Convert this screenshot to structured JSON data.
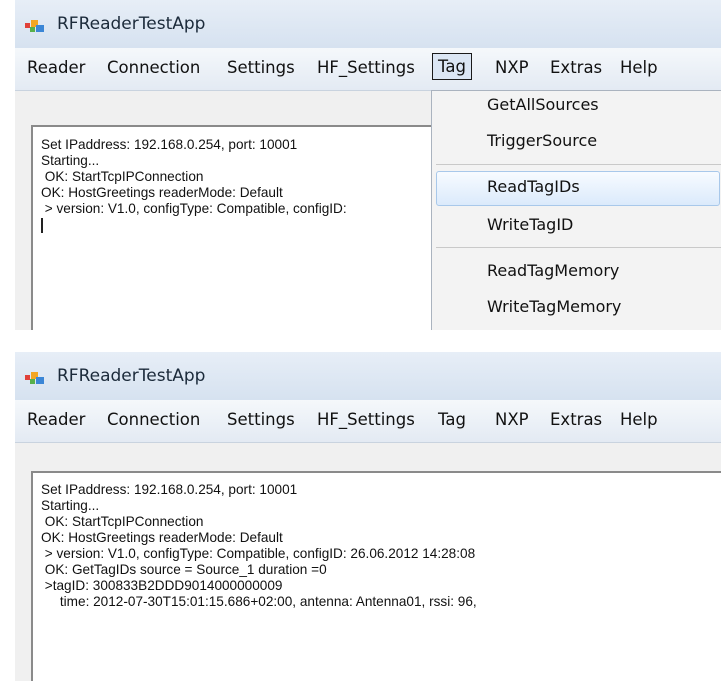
{
  "window1": {
    "title": "RFReaderTestApp",
    "menu": [
      "Reader",
      "Connection",
      "Settings",
      "HF_Settings",
      "Tag",
      "NXP",
      "Extras",
      "Help"
    ],
    "active_menu": "Tag",
    "log_lines": [
      "Set IPaddress: 192.168.0.254, port: 10001",
      "Starting...",
      " OK: StartTcpIPConnection",
      "OK: HostGreetings readerMode: Default",
      " > version: V1.0, configType: Compatible, configID:"
    ],
    "dropdown": {
      "items": [
        "GetAllSources",
        "TriggerSource",
        "ReadTagIDs",
        "WriteTagID",
        "ReadTagMemory",
        "WriteTagMemory"
      ],
      "highlighted": "ReadTagIDs"
    }
  },
  "window2": {
    "title": "RFReaderTestApp",
    "menu": [
      "Reader",
      "Connection",
      "Settings",
      "HF_Settings",
      "Tag",
      "NXP",
      "Extras",
      "Help"
    ],
    "log_lines": [
      "Set IPaddress: 192.168.0.254, port: 10001",
      "Starting...",
      " OK: StartTcpIPConnection",
      "OK: HostGreetings readerMode: Default",
      " > version: V1.0, configType: Compatible, configID: 26.06.2012 14:28:08",
      " OK: GetTagIDs source = Source_1 duration =0",
      " >tagID: 300833B2DDD9014000000009",
      "     time: 2012-07-30T15:01:15.686+02:00, antenna: Antenna01, rssi: 96,"
    ]
  },
  "colors": {
    "titlebar": "#dce6f2",
    "menubar": "#edf2f8",
    "dropdown_bg": "#f3f3f3",
    "highlight_border": "#a8c8ea",
    "console_bg": "#ffffff"
  }
}
